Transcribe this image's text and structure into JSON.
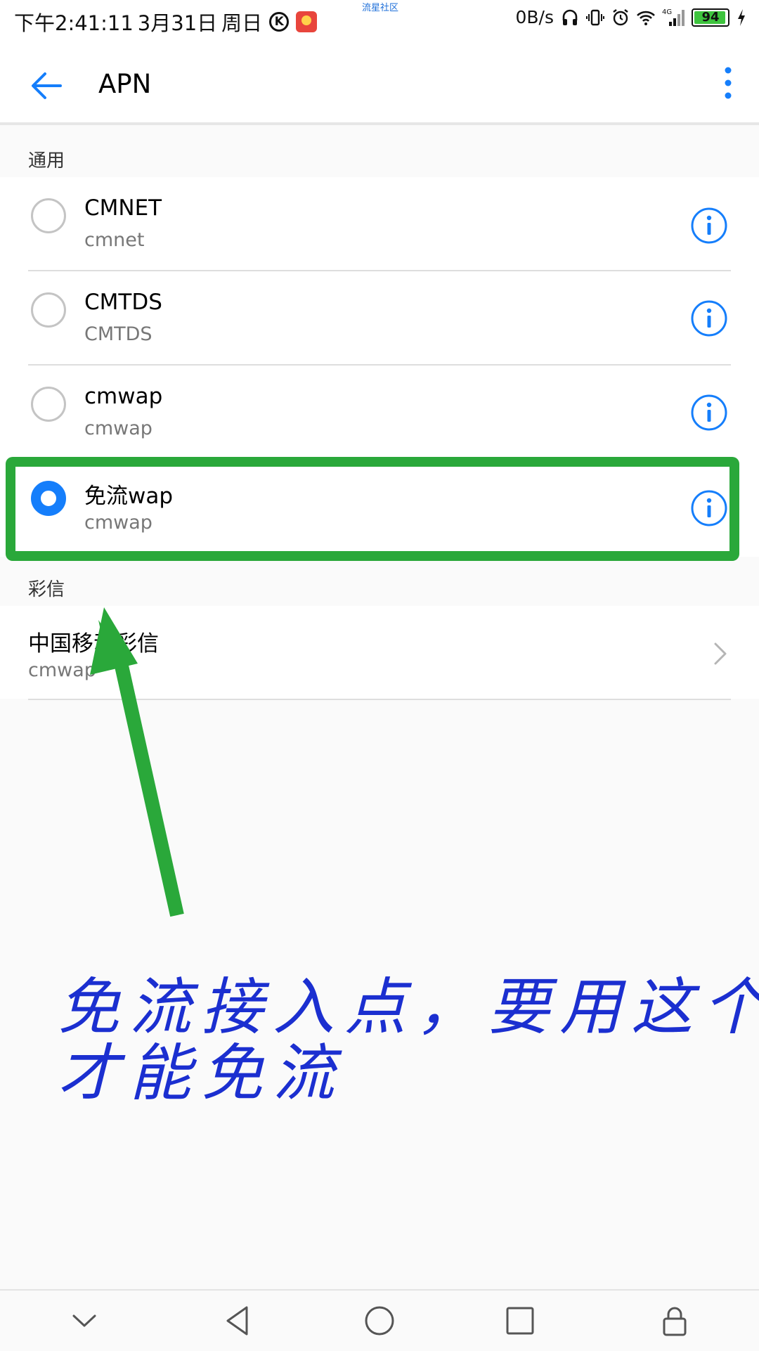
{
  "status_bar": {
    "time": "下午2:41:11",
    "date": "3月31日",
    "weekday": "周日",
    "k_icon": "K",
    "center_text": "流星社区",
    "net_speed": "0B/s",
    "signal_type": "4G",
    "battery": "94",
    "battery_color": "#3ec43e"
  },
  "app_bar": {
    "title": "APN",
    "back_icon": "arrow-left-icon",
    "more_icon": "more-vertical-icon"
  },
  "sections": {
    "general": {
      "label": "通用",
      "items": [
        {
          "name": "CMNET",
          "apn": "cmnet",
          "selected": false
        },
        {
          "name": "CMTDS",
          "apn": "CMTDS",
          "selected": false
        },
        {
          "name": "cmwap",
          "apn": "cmwap",
          "selected": false
        },
        {
          "name": "免流wap",
          "apn": "cmwap",
          "selected": true
        }
      ]
    },
    "mms": {
      "label": "彩信",
      "items": [
        {
          "name": "中国移动彩信",
          "apn": "cmwap"
        }
      ]
    }
  },
  "annotation": {
    "line1": "免流接入点，要用这个",
    "line2": "才能免流",
    "color": "#1b2fd0",
    "highlight_color": "#2aa83a"
  },
  "accent_color": "#157efb"
}
